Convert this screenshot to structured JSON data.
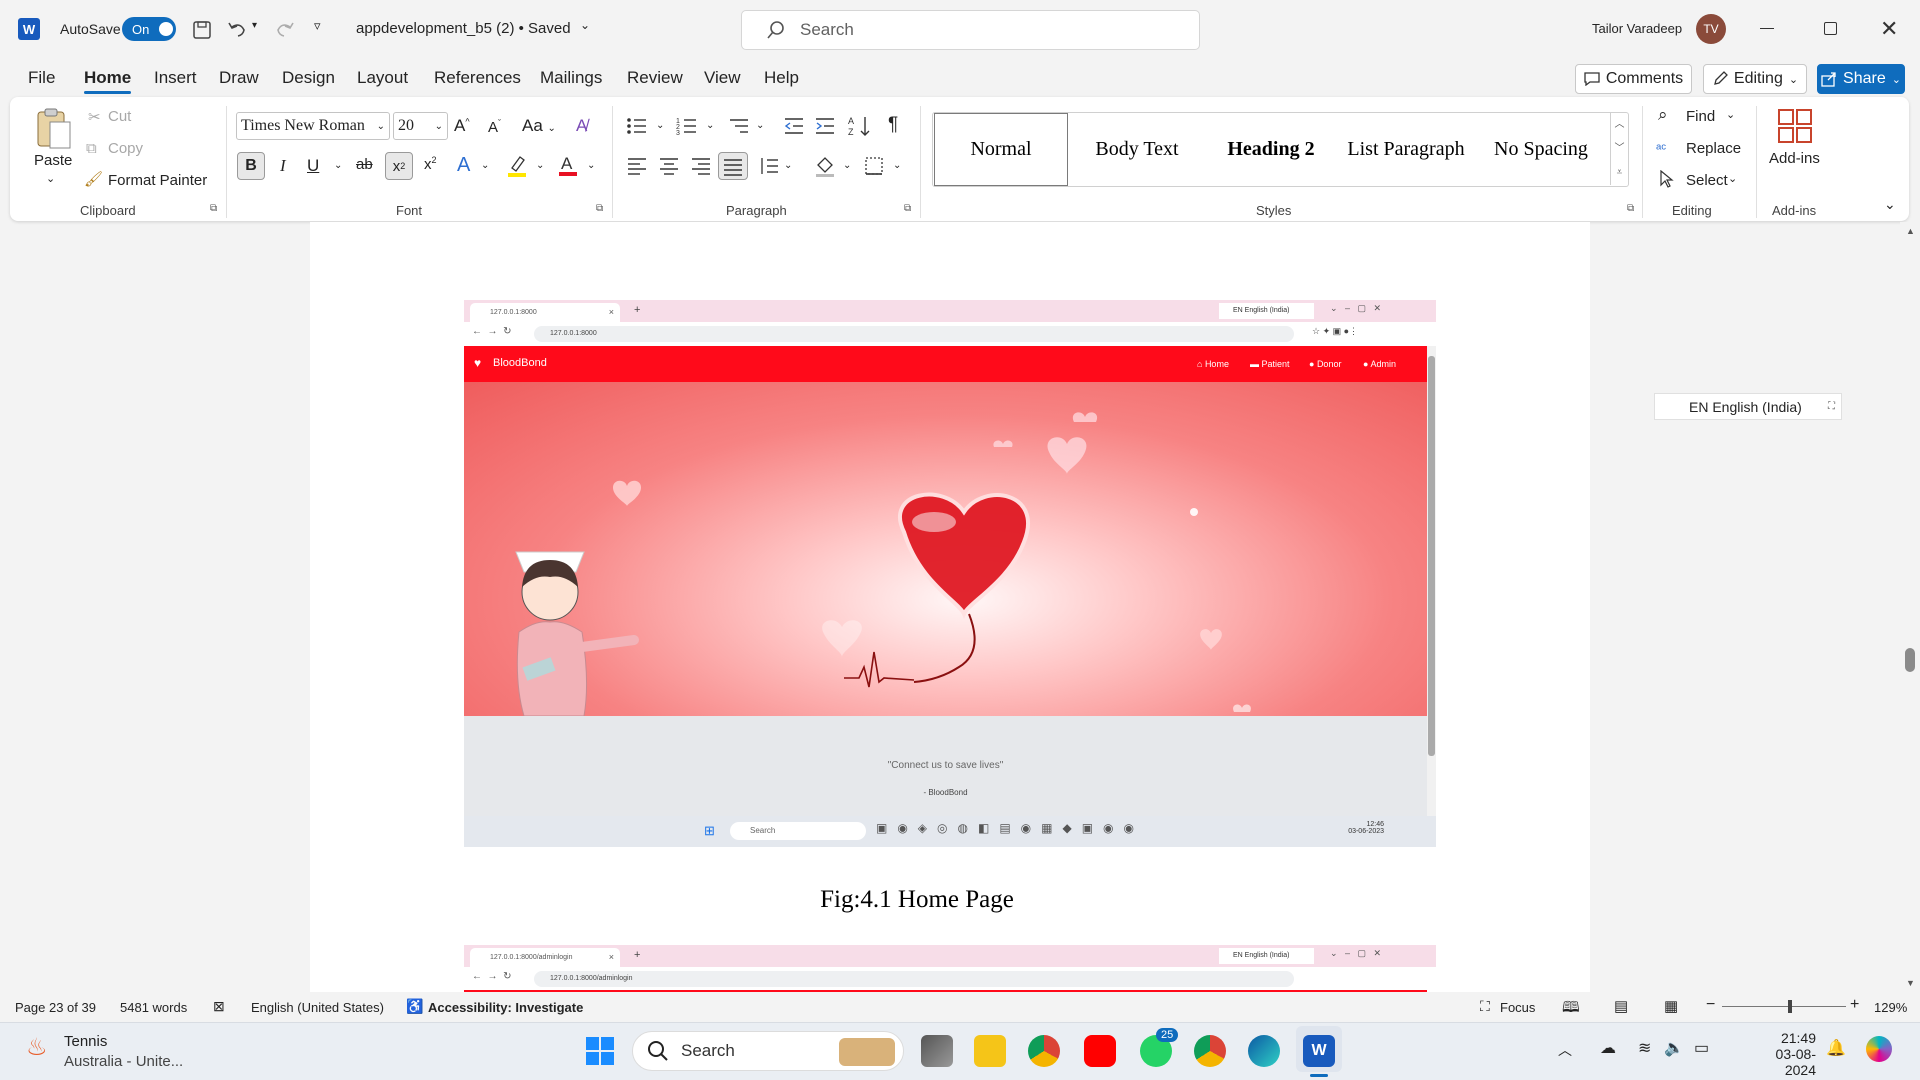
{
  "titlebar": {
    "autosave_label": "AutoSave",
    "autosave_state": "On",
    "doc_title": "appdevelopment_b5 (2) • Saved",
    "search_placeholder": "Search",
    "user_name": "Tailor Varadeep",
    "user_initials": "TV"
  },
  "menu": {
    "tabs": [
      "File",
      "Home",
      "Insert",
      "Draw",
      "Design",
      "Layout",
      "References",
      "Mailings",
      "Review",
      "View",
      "Help"
    ],
    "active": "Home",
    "comments_label": "Comments",
    "editing_label": "Editing",
    "share_label": "Share"
  },
  "ribbon": {
    "clipboard": {
      "paste": "Paste",
      "cut": "Cut",
      "copy": "Copy",
      "format_painter": "Format Painter",
      "label": "Clipboard"
    },
    "font": {
      "name": "Times New Roman",
      "size": "20",
      "label": "Font"
    },
    "paragraph": {
      "label": "Paragraph"
    },
    "styles": {
      "items": [
        "Normal",
        "Body Text",
        "Heading 2",
        "List Paragraph",
        "No Spacing"
      ],
      "label": "Styles"
    },
    "editing": {
      "find": "Find",
      "replace": "Replace",
      "select": "Select",
      "label": "Editing"
    },
    "addins": {
      "button": "Add-ins",
      "label": "Add-ins"
    }
  },
  "language_float": "EN English (India)",
  "document": {
    "figure1": {
      "browser_tab": "127.0.0.1:8000",
      "browser_url": "127.0.0.1:8000",
      "lang": "EN English (India)",
      "site_name": "BloodBond",
      "nav": [
        "Home",
        "Patient",
        "Donor",
        "Admin"
      ],
      "quote": "\"Connect us to save lives\"",
      "quote_author": "- BloodBond",
      "taskbar_search": "Search",
      "clock_time": "12:46",
      "clock_date": "03-06-2023"
    },
    "caption": "Fig:4.1 Home Page",
    "figure2": {
      "browser_tab": "127.0.0.1:8000/adminlogin",
      "browser_url": "127.0.0.1:8000/adminlogin",
      "lang": "EN English (India)"
    }
  },
  "statusbar": {
    "page": "Page 23 of 39",
    "words": "5481 words",
    "language": "English (United States)",
    "accessibility": "Accessibility: Investigate",
    "focus": "Focus",
    "zoom": "129%",
    "zoom_fraction": 0.55
  },
  "taskbar": {
    "weather_title": "Tennis",
    "weather_sub": "Australia - Unite...",
    "search": "Search",
    "whatsapp_badge": "25",
    "time": "21:49",
    "date": "03-08-2024"
  },
  "colors": {
    "accent": "#0f6cbd",
    "brand_red": "#ff0a1a",
    "word_blue": "#185abd"
  }
}
